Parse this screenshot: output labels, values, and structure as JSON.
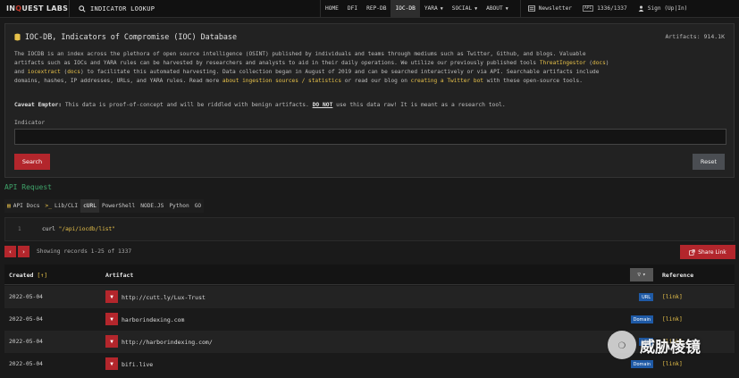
{
  "nav": {
    "logo_in": "IN",
    "logo_q": "Q",
    "logo_rest": "UEST LABS",
    "search_label": "INDICATOR LOOKUP",
    "links": [
      {
        "label": "HOME",
        "caret": false,
        "active": false
      },
      {
        "label": "DFI",
        "caret": false,
        "active": false
      },
      {
        "label": "REP-DB",
        "caret": false,
        "active": false
      },
      {
        "label": "IOC-DB",
        "caret": false,
        "active": true
      },
      {
        "label": "YARA",
        "caret": true,
        "active": false
      },
      {
        "label": "SOCIAL",
        "caret": true,
        "active": false
      },
      {
        "label": "ABOUT",
        "caret": true,
        "active": false
      }
    ],
    "newsletter": "Newsletter",
    "api_badge": "API",
    "api_count": "1336/1337",
    "signin": "Sign (Up|In)"
  },
  "card": {
    "title": "IOC-DB, Indicators of Compromise (IOC) Database",
    "artifacts": "Artifacts: 914.1K",
    "desc_l1_a": "The IOCDB is an index across the plethora of open source intelligence (OSINT) published by individuals and teams through mediums such as Twitter, Github, and blogs. Valuable",
    "desc_l2_a": "artifacts such as IOCs and YARA rules can be harvested by researchers and analysts to aid in their daily operations. We utilize our previously published tools ",
    "desc_l2_link1": "ThreatIngestor",
    "desc_l2_b": " (",
    "desc_l2_link2": "docs",
    "desc_l2_c": ")",
    "desc_l3_a": "and ",
    "desc_l3_link1": "iocextract",
    "desc_l3_b": " (",
    "desc_l3_link2": "docs",
    "desc_l3_c": ") to facilitate this automated harvesting. Data collection began in August of 2019 and can be searched interactively or via API. Searchable artifacts include",
    "desc_l4_a": "domains, hashes, IP addresses, URLs, and YARA rules. Read more ",
    "desc_l4_link1": "about ingestion sources / statistics",
    "desc_l4_b": " or read our blog on ",
    "desc_l4_link2": "creating a Twitter bot",
    "desc_l4_c": " with these open-source tools.",
    "caveat_label": "Caveat Emptor:",
    "caveat_a": " This data is proof-of-concept and will be riddled with benign artifacts. ",
    "caveat_notok": "DO NOT",
    "caveat_b": " use this data raw! It is meant as a research tool.",
    "indicator_label": "Indicator",
    "indicator_value": "",
    "search_button": "Search",
    "reset_button": "Reset"
  },
  "api": {
    "title": "API Request",
    "tabs": [
      {
        "label": "API Docs",
        "icon": "book-icon",
        "active": false
      },
      {
        "label": "Lib/CLI",
        "icon": "terminal-icon",
        "active": false
      },
      {
        "label": "cURL",
        "icon": "",
        "active": true
      },
      {
        "label": "PowerShell",
        "icon": "",
        "active": false
      },
      {
        "label": "NODE.JS",
        "icon": "",
        "active": false
      },
      {
        "label": "Python",
        "icon": "",
        "active": false
      },
      {
        "label": "GO",
        "icon": "",
        "active": false
      }
    ],
    "line_no": "1",
    "code_cmd": "curl ",
    "code_str": "\"/api/iocdb/list\""
  },
  "pager": {
    "prev": "‹",
    "next": "›",
    "showing": "Showing records 1-25 of 1337",
    "share": "Share Link"
  },
  "table": {
    "col_created": "Created",
    "col_sort": "[↑]",
    "col_artifact": "Artifact",
    "col_reference": "Reference",
    "filter_icon": "▽",
    "rows": [
      {
        "date": "2022-05-04",
        "artifact": "http://cutt.ly/Lux-Trust",
        "type": "URL",
        "ref": "[link]"
      },
      {
        "date": "2022-05-04",
        "artifact": "harborindexing.com",
        "type": "Domain",
        "ref": "[link]"
      },
      {
        "date": "2022-05-04",
        "artifact": "http://harborindexing.com/",
        "type": "URL",
        "ref": "[link]"
      },
      {
        "date": "2022-05-04",
        "artifact": "bifi.live",
        "type": "Domain",
        "ref": "[link]"
      }
    ]
  },
  "watermark": {
    "text": "威胁棱镜"
  },
  "colors": {
    "accent_red": "#b3262c",
    "link_yellow": "#e7c14a",
    "api_green": "#3fa46a",
    "badge_blue": "#1f5aa6"
  }
}
